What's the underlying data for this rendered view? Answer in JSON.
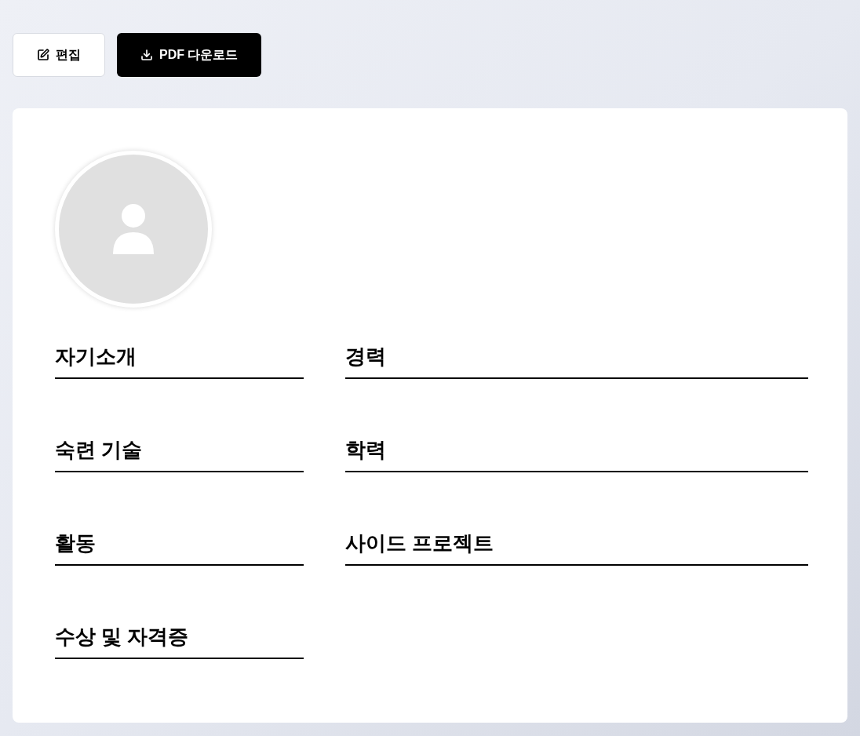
{
  "toolbar": [
    {
      "kind": "edit",
      "label": "편집",
      "primary": false
    },
    {
      "kind": "download",
      "label": "PDF 다운로드",
      "primary": true
    }
  ],
  "profile": {
    "avatar": {
      "kind": "placeholder"
    }
  },
  "sections": [
    {
      "title": "자기소개"
    },
    {
      "title": "경력"
    },
    {
      "title": "숙련 기술"
    },
    {
      "title": "학력"
    },
    {
      "title": "활동"
    },
    {
      "title": "사이드 프로젝트"
    },
    {
      "title": "수상 및 자격증"
    }
  ]
}
